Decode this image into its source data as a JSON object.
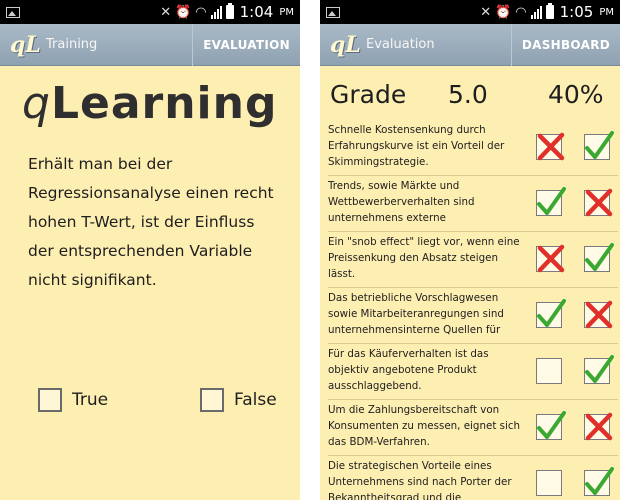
{
  "left": {
    "status": {
      "time": "1:04",
      "ampm": "PM"
    },
    "actionbar": {
      "logo": "qL",
      "title": "Training",
      "action": "EVALUATION"
    },
    "brand": {
      "prefix": "q",
      "rest": "Learning"
    },
    "question": "Erhält man bei der Regressionsanalyse einen recht hohen T-Wert, ist der Einfluss der entsprechenden Variable nicht signifikant.",
    "options": {
      "true_label": "True",
      "false_label": "False"
    }
  },
  "right": {
    "status": {
      "time": "1:05",
      "ampm": "PM"
    },
    "actionbar": {
      "logo": "qL",
      "title": "Evaluation",
      "action": "DASHBOARD"
    },
    "grade": {
      "label": "Grade",
      "value": "5.0",
      "percent": "40%"
    },
    "rows": [
      {
        "text": "Schnelle Kostensenkung durch Erfahrungskurve ist ein Vorteil der Skimmingstrategie.",
        "answer": "wrong",
        "solution": "correct"
      },
      {
        "text": "Trends, sowie Märkte und Wettbewerberverhalten sind unternehmens externe",
        "answer": "correct",
        "solution": "wrong"
      },
      {
        "text": "Ein \"snob effect\" liegt vor, wenn eine Preissenkung den Absatz steigen lässt.",
        "answer": "wrong",
        "solution": "correct"
      },
      {
        "text": "Das betriebliche Vorschlagwesen sowie Mitarbeiteranregungen sind unternehmensinterne Quellen für",
        "answer": "correct",
        "solution": "wrong"
      },
      {
        "text": "Für das Käuferverhalten ist das objektiv angebotene Produkt ausschlaggebend.",
        "answer": "empty",
        "solution": "correct"
      },
      {
        "text": "Um die Zahlungsbereitschaft von Konsumenten zu messen, eignet sich das BDM-Verfahren.",
        "answer": "correct",
        "solution": "wrong"
      },
      {
        "text": "Die strategischen Vorteile eines Unternehmens sind nach Porter der Bekanntheitsgrad und die",
        "answer": "empty",
        "solution": "correct"
      }
    ]
  },
  "colors": {
    "check": "#3aa832",
    "cross": "#e0302a",
    "paper": "#fdeeb2",
    "actionbar": "#9aacbb"
  },
  "icons": {
    "status_left": "image-icon",
    "mute": "mute-icon",
    "alarm": "alarm-icon",
    "wifi": "wifi-icon",
    "signal": "signal-icon",
    "battery": "battery-icon"
  }
}
